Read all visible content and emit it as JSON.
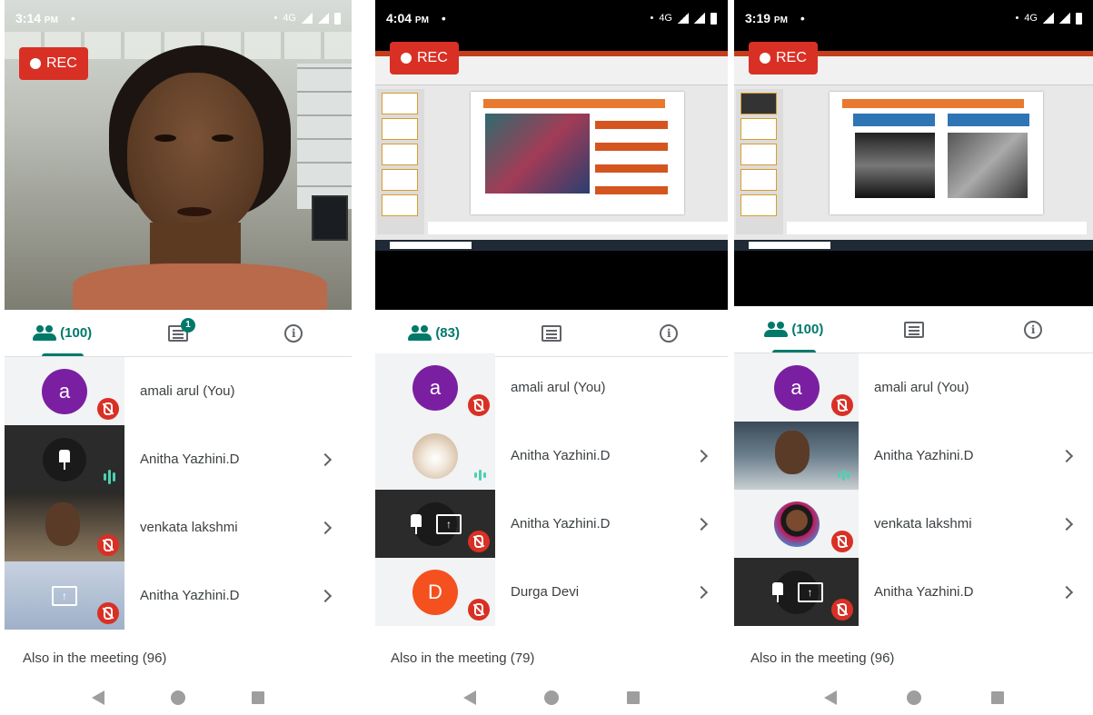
{
  "colors": {
    "accent": "#00796b",
    "rec": "#d93025",
    "avatar_purple": "#7b1fa2",
    "avatar_orange": "#f4511e"
  },
  "phones": [
    {
      "status_time": "3:14",
      "status_ampm": "PM",
      "network": "4G",
      "rec_label": "REC",
      "people_count": "(100)",
      "chat_badge": "1",
      "participants": [
        {
          "avatar_letter": "a",
          "name": "amali arul (You)"
        },
        {
          "name": "Anitha Yazhini.D"
        },
        {
          "name": "venkata lakshmi"
        },
        {
          "name": "Anitha Yazhini.D"
        }
      ],
      "also_label": "Also in the meeting (96)"
    },
    {
      "status_time": "4:04",
      "status_ampm": "PM",
      "network": "4G",
      "rec_label": "REC",
      "people_count": "(83)",
      "participants": [
        {
          "avatar_letter": "a",
          "name": "amali arul (You)"
        },
        {
          "name": "Anitha Yazhini.D"
        },
        {
          "name": "Anitha Yazhini.D"
        },
        {
          "avatar_letter": "D",
          "name": "Durga Devi"
        }
      ],
      "also_label": "Also in the meeting (79)"
    },
    {
      "status_time": "3:19",
      "status_ampm": "PM",
      "network": "4G",
      "rec_label": "REC",
      "people_count": "(100)",
      "participants": [
        {
          "avatar_letter": "a",
          "name": "amali arul (You)"
        },
        {
          "name": "Anitha Yazhini.D"
        },
        {
          "name": "venkata lakshmi"
        },
        {
          "name": "Anitha Yazhini.D"
        }
      ],
      "also_label": "Also in the meeting (96)"
    }
  ]
}
